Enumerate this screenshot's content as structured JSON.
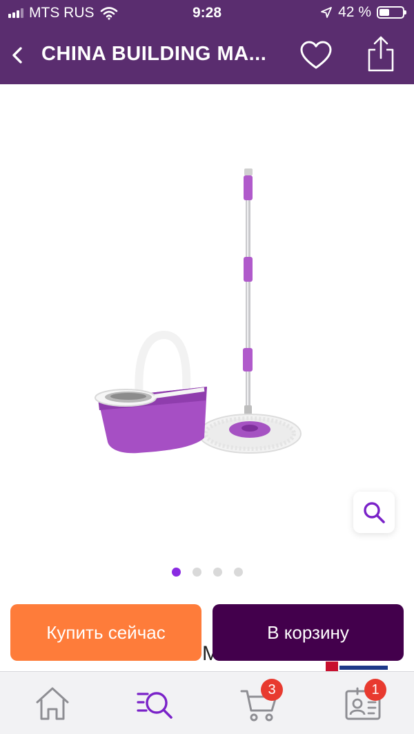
{
  "status_bar": {
    "carrier": "MTS RUS",
    "time": "9:28",
    "battery": "42 %",
    "icons": [
      "signal-icon",
      "wifi-icon",
      "location-arrow-icon",
      "battery-icon"
    ]
  },
  "navbar": {
    "title": "CHINA BUILDING MA...",
    "icons": [
      "back-chevron-icon",
      "heart-icon",
      "share-icon"
    ]
  },
  "gallery": {
    "image": "spin-mop-bucket-product-image",
    "page_count": 4,
    "active_index": 0
  },
  "actions": {
    "buy_now": "Купить сейчас",
    "add_to_cart": "В корзину"
  },
  "peek": {
    "text": "CHINA BUILDING MATERIAL"
  },
  "tabbar": {
    "items": [
      {
        "name": "home",
        "icon": "home-icon"
      },
      {
        "name": "search",
        "icon": "search-list-icon",
        "active": true
      },
      {
        "name": "cart",
        "icon": "cart-icon",
        "badge": "3"
      },
      {
        "name": "profile",
        "icon": "profile-card-icon",
        "badge": "1"
      }
    ]
  },
  "colors": {
    "header": "#5a2d6f",
    "buy_button": "#fe7c3a",
    "cart_button": "#43004c",
    "accent": "#8a2be2",
    "badge": "#e83a2f"
  }
}
